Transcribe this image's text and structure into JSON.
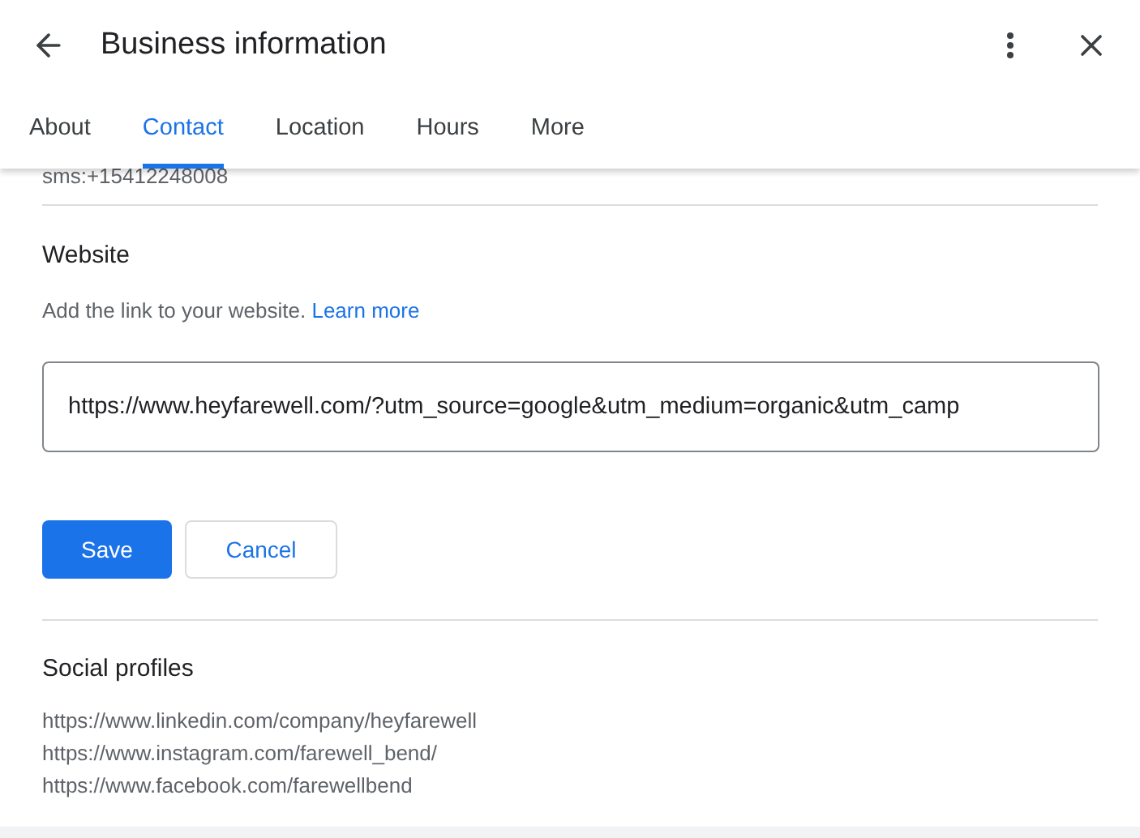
{
  "header": {
    "title": "Business information"
  },
  "tabs": [
    {
      "label": "About",
      "selected": false
    },
    {
      "label": "Contact",
      "selected": true
    },
    {
      "label": "Location",
      "selected": false
    },
    {
      "label": "Hours",
      "selected": false
    },
    {
      "label": "More",
      "selected": false
    }
  ],
  "previous_value": "sms:+15412248008",
  "website": {
    "heading": "Website",
    "description": "Add the link to your website.",
    "link": "Learn more",
    "value": "https://www.heyfarewell.com/?utm_source=google&utm_medium=organic&utm_camp"
  },
  "buttons": {
    "save": "Save",
    "cancel": "Cancel"
  },
  "social": {
    "heading": "Social profiles",
    "links": [
      "https://www.linkedin.com/company/heyfarewell",
      "https://www.instagram.com/farewell_bend/",
      "https://www.facebook.com/farewellbend"
    ]
  }
}
